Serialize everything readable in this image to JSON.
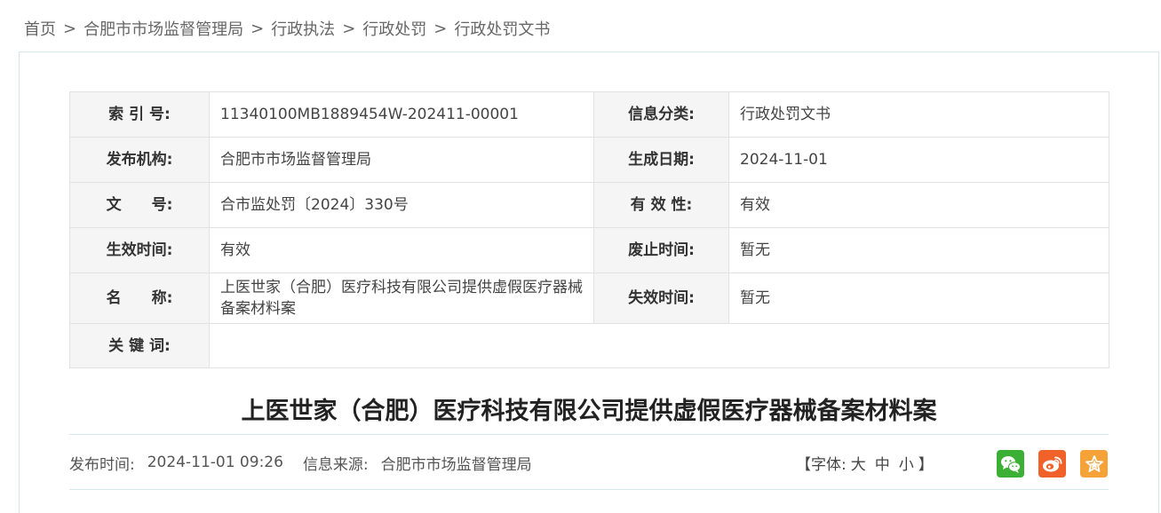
{
  "breadcrumb": {
    "items": [
      "首页",
      "合肥市市场监督管理局",
      "行政执法",
      "行政处罚",
      "行政处罚文书"
    ],
    "separator": ">"
  },
  "meta": {
    "index_no_label": "索 引 号:",
    "index_no": "11340100MB1889454W-202411-00001",
    "category_label": "信息分类:",
    "category": "行政处罚文书",
    "publisher_label": "发布机构:",
    "publisher": "合肥市市场监督管理局",
    "created_date_label": "生成日期:",
    "created_date": "2024-11-01",
    "doc_no_label": "文　　号:",
    "doc_no": "合市监处罚〔2024〕330号",
    "validity_label": "有 效 性:",
    "validity": "有效",
    "effective_time_label": "生效时间:",
    "effective_time": "有效",
    "repeal_time_label": "废止时间:",
    "repeal_time": "暂无",
    "name_label": "名　　称:",
    "name": "上医世家（合肥）医疗科技有限公司提供虚假医疗器械备案材料案",
    "expire_time_label": "失效时间:",
    "expire_time": "暂无",
    "keywords_label": "关 键 词:",
    "keywords": ""
  },
  "article": {
    "title": "上医世家（合肥）医疗科技有限公司提供虚假医疗器械备案材料案",
    "publish_time_label": "发布时间:",
    "publish_time": "2024-11-01 09:26",
    "source_label": "信息来源:",
    "source": "合肥市市场监督管理局"
  },
  "font_size": {
    "open": "【字体:",
    "large": "大",
    "medium": "中",
    "small": "小",
    "close": "】"
  },
  "share": {
    "wechat_color": "#3cb034",
    "weibo_color": "#f0622a",
    "favorite_color": "#f5a338",
    "icons": [
      "wechat-icon",
      "weibo-icon",
      "star-icon"
    ]
  }
}
